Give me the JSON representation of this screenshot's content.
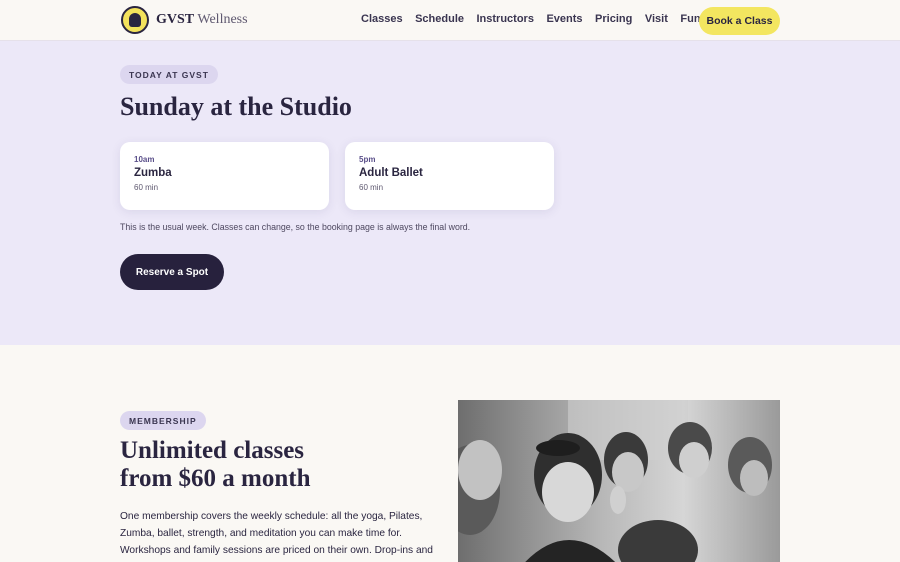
{
  "nav": {
    "brand_bold": "GVST",
    "brand_light": " Wellness",
    "items": [
      "Classes",
      "Schedule",
      "Instructors",
      "Events",
      "Pricing",
      "Visit",
      "Fun Tools"
    ],
    "cta": "Book a Class"
  },
  "today": {
    "eyebrow": "TODAY AT GVST",
    "title": "Sunday at the Studio",
    "classes": [
      {
        "time": "10am",
        "name": "Zumba",
        "duration": "60 min"
      },
      {
        "time": "5pm",
        "name": "Adult Ballet",
        "duration": "60 min"
      }
    ],
    "note": "This is the usual week. Classes can change, so the booking page is always the final word.",
    "cta": "Reserve a Spot"
  },
  "membership": {
    "eyebrow": "MEMBERSHIP",
    "title_line1": "Unlimited classes",
    "title_line2": "from $60 a month",
    "body": "One membership covers the weekly schedule: all the yoga, Pilates, Zumba, ballet, strength, and meditation you can make time for. Workshops and family sessions are priced on their own. Drop-ins and"
  },
  "colors": {
    "accent_yellow": "#f3e660",
    "dark": "#27213d",
    "lavender_bg": "#ece8f8"
  }
}
